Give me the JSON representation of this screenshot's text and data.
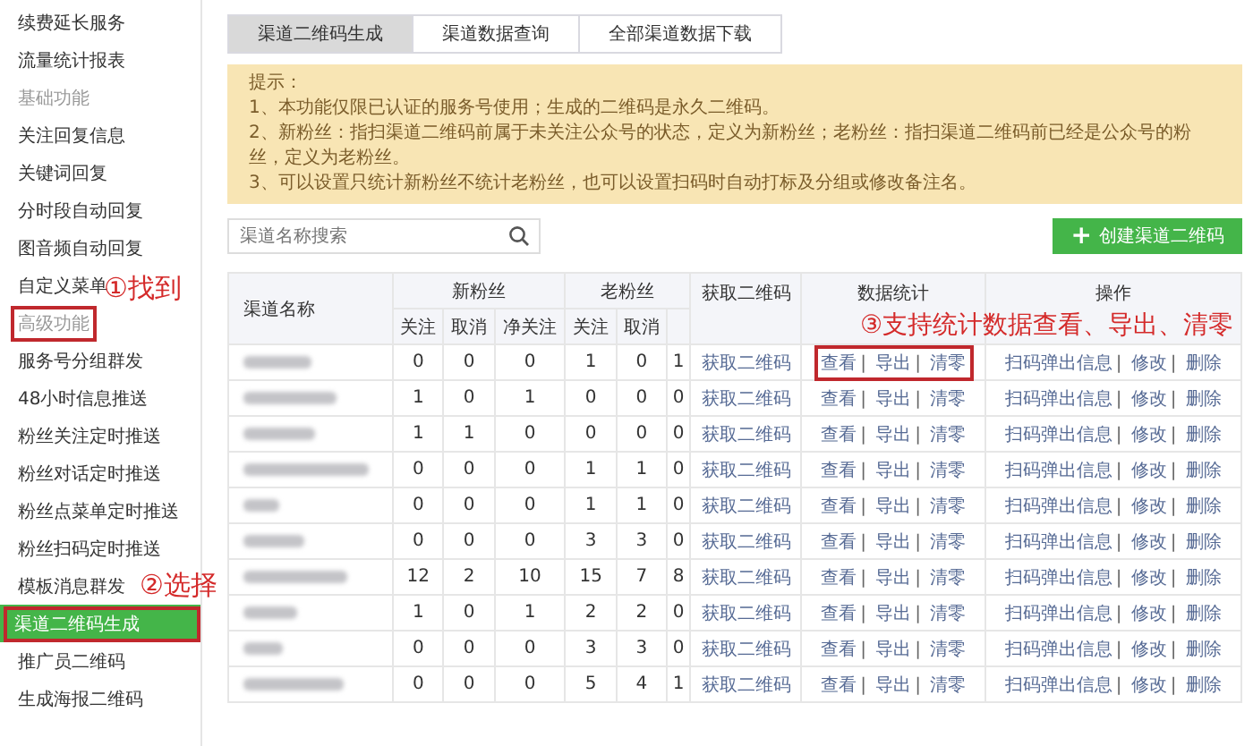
{
  "sidebar": {
    "items": [
      {
        "kind": "item",
        "label": "续费延长服务",
        "selected": false,
        "highlighted": false
      },
      {
        "kind": "item",
        "label": "流量统计报表",
        "selected": false,
        "highlighted": false
      },
      {
        "kind": "section",
        "label": "基础功能",
        "highlighted": false
      },
      {
        "kind": "item",
        "label": "关注回复信息",
        "selected": false,
        "highlighted": false
      },
      {
        "kind": "item",
        "label": "关键词回复",
        "selected": false,
        "highlighted": false
      },
      {
        "kind": "item",
        "label": "分时段自动回复",
        "selected": false,
        "highlighted": false
      },
      {
        "kind": "item",
        "label": "图音频自动回复",
        "selected": false,
        "highlighted": false
      },
      {
        "kind": "item",
        "label": "自定义菜单",
        "selected": false,
        "highlighted": false
      },
      {
        "kind": "section",
        "label": "高级功能",
        "highlighted": true,
        "annotation": "①找到"
      },
      {
        "kind": "item",
        "label": "服务号分组群发",
        "selected": false,
        "highlighted": false
      },
      {
        "kind": "item",
        "label": "48小时信息推送",
        "selected": false,
        "highlighted": false
      },
      {
        "kind": "item",
        "label": "粉丝关注定时推送",
        "selected": false,
        "highlighted": false
      },
      {
        "kind": "item",
        "label": "粉丝对话定时推送",
        "selected": false,
        "highlighted": false
      },
      {
        "kind": "item",
        "label": "粉丝点菜单定时推送",
        "selected": false,
        "highlighted": false
      },
      {
        "kind": "item",
        "label": "粉丝扫码定时推送",
        "selected": false,
        "highlighted": false
      },
      {
        "kind": "item",
        "label": "模板消息群发",
        "selected": false,
        "highlighted": false
      },
      {
        "kind": "item",
        "label": "渠道二维码生成",
        "selected": true,
        "highlighted": true,
        "annotation": "②选择"
      },
      {
        "kind": "item",
        "label": "推广员二维码",
        "selected": false,
        "highlighted": false
      },
      {
        "kind": "item",
        "label": "生成海报二维码",
        "selected": false,
        "highlighted": false
      }
    ]
  },
  "tabs": [
    {
      "label": "渠道二维码生成",
      "selected": true
    },
    {
      "label": "渠道数据查询",
      "selected": false
    },
    {
      "label": "全部渠道数据下载",
      "selected": false
    }
  ],
  "notice": {
    "title": "提示：",
    "lines": [
      "1、本功能仅限已认证的服务号使用；生成的二维码是永久二维码。",
      "2、新粉丝：指扫渠道二维码前属于未关注公众号的状态，定义为新粉丝；老粉丝：指扫渠道二维码前已经是公众号的粉丝，定义为老粉丝。",
      "3、可以设置只统计新粉丝不统计老粉丝，也可以设置扫码时自动打标及分组或修改备注名。"
    ]
  },
  "search": {
    "placeholder": "渠道名称搜索"
  },
  "create_button": {
    "icon": "+",
    "label": "创建渠道二维码"
  },
  "table": {
    "name_header": "渠道名称",
    "groups": [
      {
        "label": "新粉丝",
        "columns": [
          "关注",
          "取消",
          "净关注"
        ]
      },
      {
        "label": "老粉丝",
        "columns": [
          "关注",
          "取消",
          ""
        ]
      }
    ],
    "qr_header": "获取二维码",
    "stats_header": "数据统计",
    "ops_header": "操作",
    "link_separator": "|",
    "rows": [
      {
        "values": [
          "0",
          "0",
          "0",
          "1",
          "0",
          "1"
        ],
        "qr_link": "获取二维码",
        "stats_links": [
          "查看",
          "导出",
          "清零"
        ],
        "ops_links": [
          "扫码弹出信息",
          "修改",
          "删除"
        ],
        "highlighted": true,
        "annotation": "③支持统计数据查看、导出、清零"
      },
      {
        "values": [
          "1",
          "0",
          "1",
          "0",
          "0",
          "0"
        ],
        "qr_link": "获取二维码",
        "stats_links": [
          "查看",
          "导出",
          "清零"
        ],
        "ops_links": [
          "扫码弹出信息",
          "修改",
          "删除"
        ],
        "highlighted": false
      },
      {
        "values": [
          "1",
          "1",
          "0",
          "0",
          "0",
          "0"
        ],
        "qr_link": "获取二维码",
        "stats_links": [
          "查看",
          "导出",
          "清零"
        ],
        "ops_links": [
          "扫码弹出信息",
          "修改",
          "删除"
        ],
        "highlighted": false
      },
      {
        "values": [
          "0",
          "0",
          "0",
          "1",
          "1",
          "0"
        ],
        "qr_link": "获取二维码",
        "stats_links": [
          "查看",
          "导出",
          "清零"
        ],
        "ops_links": [
          "扫码弹出信息",
          "修改",
          "删除"
        ],
        "highlighted": false
      },
      {
        "values": [
          "0",
          "0",
          "0",
          "1",
          "1",
          "0"
        ],
        "qr_link": "获取二维码",
        "stats_links": [
          "查看",
          "导出",
          "清零"
        ],
        "ops_links": [
          "扫码弹出信息",
          "修改",
          "删除"
        ],
        "highlighted": false
      },
      {
        "values": [
          "0",
          "0",
          "0",
          "3",
          "3",
          "0"
        ],
        "qr_link": "获取二维码",
        "stats_links": [
          "查看",
          "导出",
          "清零"
        ],
        "ops_links": [
          "扫码弹出信息",
          "修改",
          "删除"
        ],
        "highlighted": false
      },
      {
        "values": [
          "12",
          "2",
          "10",
          "15",
          "7",
          "8"
        ],
        "qr_link": "获取二维码",
        "stats_links": [
          "查看",
          "导出",
          "清零"
        ],
        "ops_links": [
          "扫码弹出信息",
          "修改",
          "删除"
        ],
        "highlighted": false
      },
      {
        "values": [
          "1",
          "0",
          "1",
          "2",
          "2",
          "0"
        ],
        "qr_link": "获取二维码",
        "stats_links": [
          "查看",
          "导出",
          "清零"
        ],
        "ops_links": [
          "扫码弹出信息",
          "修改",
          "删除"
        ],
        "highlighted": false
      },
      {
        "values": [
          "0",
          "0",
          "0",
          "3",
          "3",
          "0"
        ],
        "qr_link": "获取二维码",
        "stats_links": [
          "查看",
          "导出",
          "清零"
        ],
        "ops_links": [
          "扫码弹出信息",
          "修改",
          "删除"
        ],
        "highlighted": false
      },
      {
        "values": [
          "0",
          "0",
          "0",
          "5",
          "4",
          "1"
        ],
        "qr_link": "获取二维码",
        "stats_links": [
          "查看",
          "导出",
          "清零"
        ],
        "ops_links": [
          "扫码弹出信息",
          "修改",
          "删除"
        ],
        "highlighted": false
      }
    ]
  }
}
